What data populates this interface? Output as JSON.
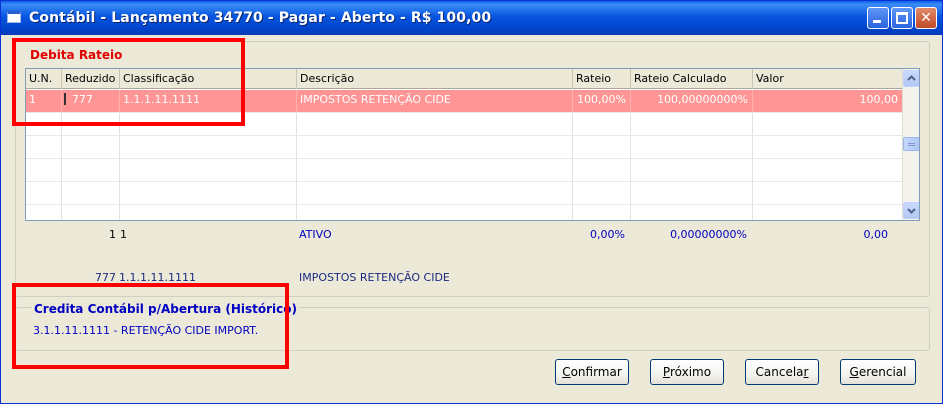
{
  "window": {
    "title": "Contábil - Lançamento 34770 - Pagar - Aberto - R$ 100,00",
    "close_glyph": "✕"
  },
  "debita": {
    "title": "Debita Rateio",
    "columns": [
      "U.N.",
      "Reduzido",
      "Classificação",
      "Descrição",
      "Rateio",
      "Rateio Calculado",
      "Valor"
    ],
    "rows": [
      {
        "un": "1",
        "reduzido": "777",
        "classificacao": "1.1.1.11.1111",
        "descricao": "IMPOSTOS RETENÇÃO CIDE",
        "rateio": "100,00%",
        "rateio_calculado": "100,00000000%",
        "valor": "100,00"
      },
      {
        "un": "",
        "reduzido": "",
        "classificacao": "",
        "descricao": "",
        "rateio": "",
        "rateio_calculado": "",
        "valor": ""
      },
      {
        "un": "",
        "reduzido": "",
        "classificacao": "",
        "descricao": "",
        "rateio": "",
        "rateio_calculado": "",
        "valor": ""
      },
      {
        "un": "",
        "reduzido": "",
        "classificacao": "",
        "descricao": "",
        "rateio": "",
        "rateio_calculado": "",
        "valor": ""
      },
      {
        "un": "",
        "reduzido": "",
        "classificacao": "",
        "descricao": "",
        "rateio": "",
        "rateio_calculado": "",
        "valor": ""
      },
      {
        "un": "",
        "reduzido": "",
        "classificacao": "",
        "descricao": "",
        "rateio": "",
        "rateio_calculado": "",
        "valor": ""
      }
    ],
    "summary": {
      "un": "1",
      "reduzido": "1",
      "descricao": "ATIVO",
      "rateio": "0,00%",
      "rateio_calculado": "0,00000000%",
      "valor": "0,00"
    },
    "selected_info": {
      "reduzido": "777",
      "classificacao": "1.1.1.11.1111",
      "descricao": "IMPOSTOS RETENÇÃO CIDE"
    }
  },
  "credita": {
    "title": "Credita Contábil p/Abertura (Histórico)",
    "text": "3.1.1.11.1111 - RETENÇÃO CIDE IMPORT."
  },
  "buttons": {
    "confirmar": {
      "mnemonic": "C",
      "rest": "onfirmar"
    },
    "proximo": {
      "mnemonic": "P",
      "rest": "róximo"
    },
    "cancelar": {
      "pre": "Cancela",
      "mnemonic": "r"
    },
    "gerencial": {
      "mnemonic": "G",
      "rest": "erencial"
    }
  },
  "colors": {
    "selected_row": "#ff9595",
    "highlight_box": "#ff0000",
    "debita_title": "#e00000",
    "credita_title": "#0000c0"
  }
}
